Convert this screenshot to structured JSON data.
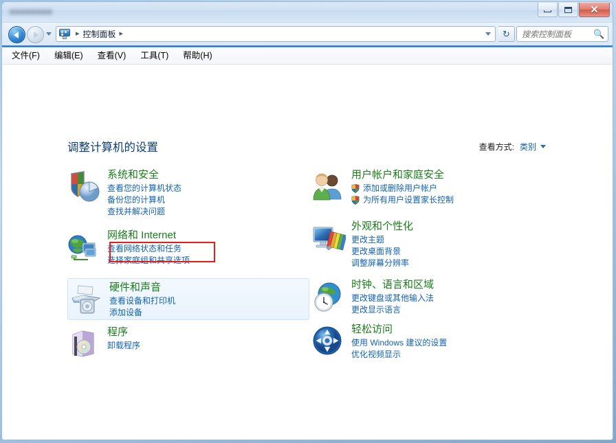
{
  "window": {
    "title_obscured": "■■■■■■■■",
    "buttons": {
      "minimize": "最小化",
      "maximize": "最大化",
      "close": "✕"
    }
  },
  "nav": {
    "back_label": "后退",
    "forward_label": "前进",
    "recent_label": "最近访问的位置",
    "address_icon": "control-panel-icon",
    "breadcrumb": [
      "控制面板"
    ],
    "separator": "▸",
    "refresh_label": "↻"
  },
  "search": {
    "placeholder": "搜索控制面板",
    "value": "",
    "icon": "search-icon"
  },
  "menubar": {
    "items": [
      {
        "label": "文件(F)"
      },
      {
        "label": "编辑(E)"
      },
      {
        "label": "查看(V)"
      },
      {
        "label": "工具(T)"
      },
      {
        "label": "帮助(H)"
      }
    ]
  },
  "page": {
    "title": "调整计算机的设置",
    "view_by_label": "查看方式:",
    "view_by_value": "类别"
  },
  "categories": {
    "left": [
      {
        "icon": "security-shield-icon",
        "title": "系统和安全",
        "links": [
          {
            "label": "查看您的计算机状态",
            "shield": false
          },
          {
            "label": "备份您的计算机",
            "shield": false
          },
          {
            "label": "查找并解决问题",
            "shield": false
          }
        ]
      },
      {
        "icon": "network-globe-icon",
        "title": "网络和 Internet",
        "links": [
          {
            "label": "查看网络状态和任务",
            "shield": false
          },
          {
            "label": "选择家庭组和共享选项",
            "shield": false
          }
        ]
      },
      {
        "icon": "printer-icon",
        "title": "硬件和声音",
        "links": [
          {
            "label": "查看设备和打印机",
            "shield": false
          },
          {
            "label": "添加设备",
            "shield": false
          }
        ]
      },
      {
        "icon": "programs-icon",
        "title": "程序",
        "links": [
          {
            "label": "卸载程序",
            "shield": false
          }
        ]
      }
    ],
    "right": [
      {
        "icon": "users-icon",
        "title": "用户帐户和家庭安全",
        "links": [
          {
            "label": "添加或删除用户帐户",
            "shield": true
          },
          {
            "label": "为所有用户设置家长控制",
            "shield": true
          }
        ]
      },
      {
        "icon": "appearance-icon",
        "title": "外观和个性化",
        "links": [
          {
            "label": "更改主题",
            "shield": false
          },
          {
            "label": "更改桌面背景",
            "shield": false
          },
          {
            "label": "调整屏幕分辨率",
            "shield": false
          }
        ]
      },
      {
        "icon": "clock-globe-icon",
        "title": "时钟、语言和区域",
        "links": [
          {
            "label": "更改键盘或其他输入法",
            "shield": false
          },
          {
            "label": "更改显示语言",
            "shield": false
          }
        ]
      },
      {
        "icon": "ease-of-access-icon",
        "title": "轻松访问",
        "links": [
          {
            "label": "使用 Windows 建议的设置",
            "shield": false
          },
          {
            "label": "优化视频显示",
            "shield": false
          }
        ]
      }
    ]
  },
  "annotation": {
    "highlight_target": "查看网络状态和任务",
    "highlight_color": "#e81a1a"
  },
  "colors": {
    "category_title": "#1a7d1a",
    "link": "#1262b3",
    "page_heading": "#0c3f77",
    "hover_fill": "#eaf4fd"
  }
}
